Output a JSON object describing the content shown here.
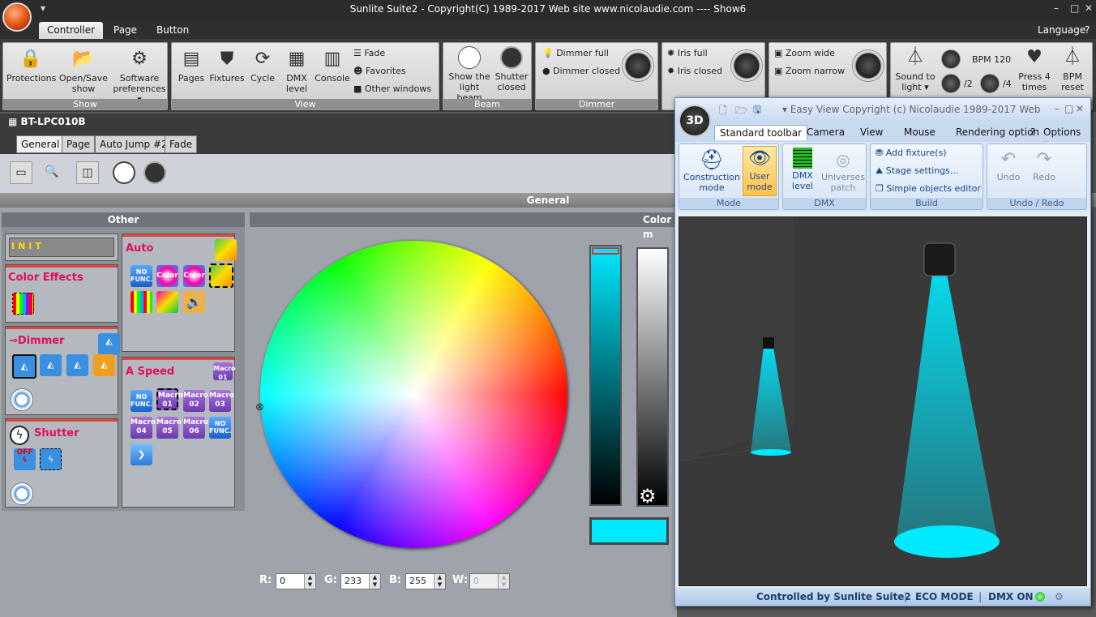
{
  "window": {
    "title": "Sunlite Suite2 - Copyright(C) 1989-2017    Web site www.nicolaudie.com ---- Show6",
    "min": "–",
    "restore": "□",
    "close": "✕"
  },
  "menu_tabs": [
    "Controller",
    "Page",
    "Button"
  ],
  "language": "Language ▾",
  "help": "?",
  "ribbon": {
    "show": {
      "label": "Show",
      "protections": "Protections",
      "opensave": "Open/Save\nshow",
      "software": "Software\npreferences ▾"
    },
    "view": {
      "label": "View",
      "pages": "Pages",
      "fixtures": "Fixtures",
      "cycle": "Cycle",
      "dmx": "DMX\nlevel",
      "console": "Console",
      "fade": "Fade",
      "favorites": "Favorites",
      "other": "Other windows"
    },
    "beam": {
      "label": "Beam",
      "show_beam": "Show the\nlight beam",
      "shutter": "Shutter\nclosed"
    },
    "dimmer": {
      "label": "Dimmer",
      "full": "Dimmer full",
      "closed": "Dimmer closed"
    },
    "iris": {
      "full": "Iris full",
      "closed": "Iris closed"
    },
    "zoom": {
      "wide": "Zoom wide",
      "narrow": "Zoom narrow"
    },
    "sound": {
      "sound": "Sound to\nlight ▾",
      "bpm": "BPM 120",
      "div2": "/2",
      "div4": "/4",
      "press": "Press 4\ntimes",
      "reset": "BPM\nreset"
    }
  },
  "fixture": {
    "name": "BT-LPC010B"
  },
  "control_tabs": [
    "General",
    "Page",
    "Auto Jump #2",
    "Fade"
  ],
  "general_label": "General",
  "other_label": "Other",
  "color_label": "Color m",
  "boxes": {
    "init": "INIT",
    "color_effects": "Color Effects",
    "dimmer": "Dimmer",
    "shutter": "Shutter",
    "auto": "Auto",
    "aspeed": "A Speed"
  },
  "auto_icons": {
    "nofunc": "NO\nFUNC.",
    "color1": "Color",
    "color2": "Color"
  },
  "aspeed_icons": {
    "nofunc1": "NO\nFUNC.",
    "m01": "Macro\n01",
    "m02": "Macro\n02",
    "m03": "Macro\n03",
    "m04": "Macro\n04",
    "m05": "Macro\n05",
    "m06": "Macro\n06",
    "nofunc2": "NO\nFUNC.",
    "hdr": "Macro\n01"
  },
  "shutter_off": "OFF",
  "rgb": {
    "r_label": "R:",
    "r": "0",
    "g_label": "G:",
    "g": "233",
    "b_label": "B:",
    "b": "255",
    "w_label": "W:",
    "w": "0"
  },
  "colors": {
    "selected": "#00e9ff",
    "accent": "#e0105e"
  },
  "easyview": {
    "title": "Easy View   Copyright (c) Nicolaudie 1989-2017    Web ...",
    "badge": "3D",
    "tabs": [
      "Standard toolbar",
      "Camera",
      "View",
      "Mouse",
      "Rendering option",
      "?",
      "Options ▾"
    ],
    "mode": {
      "label": "Mode",
      "construction": "Construction\nmode",
      "user": "User\nmode"
    },
    "dmx": {
      "label": "DMX",
      "level": "DMX\nlevel",
      "patch": "Universes\npatch"
    },
    "build": {
      "label": "Build",
      "add": "Add fixture(s)",
      "stage": "Stage settings...",
      "simple": "Simple objects editor"
    },
    "undo": {
      "label": "Undo / Redo",
      "undo": "Undo",
      "redo": "Redo"
    },
    "status": {
      "controlled": "Controlled by Sunlite Suite2",
      "eco": "ECO MODE",
      "dmx": "DMX ON"
    }
  }
}
